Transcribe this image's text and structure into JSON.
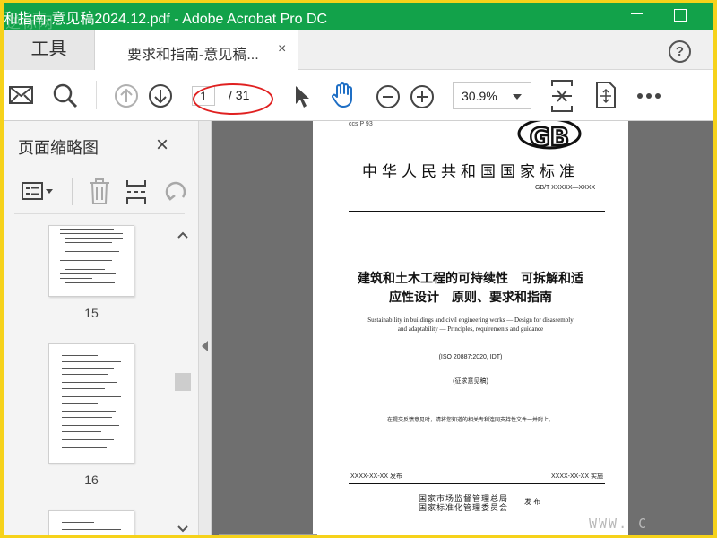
{
  "window": {
    "title": "和指南-意见稿2024.12.pdf - Adobe Acrobat Pro DC",
    "brand_overlay": "逆标网"
  },
  "tabs": {
    "tools": "工具",
    "document": "要求和指南-意见稿...",
    "close": "×",
    "help": "?"
  },
  "toolbar": {
    "page_current": "1",
    "page_total": "/ 31",
    "zoom": "30.9%"
  },
  "thumbnail_panel": {
    "title": "页面缩略图",
    "close": "×",
    "page_numbers": [
      "15",
      "16"
    ]
  },
  "page": {
    "ccs": "ccs P 93",
    "logo": "GB",
    "national_standard": "中华人民共和国国家标准",
    "std_number": "GB/T XXXXX—XXXX",
    "title_line1": "建筑和土木工程的可持续性　可拆解和适",
    "title_line2": "应性设计　原则、要求和指南",
    "english_line1": "Sustainability in buildings and civil engineering works — Design for disassembly",
    "english_line2": "and adaptability — Principles, requirements and guidance",
    "iso_ref": "(ISO 20887:2020, IDT)",
    "draft_label": "(征求意见稿)",
    "note": "在提交反馈意见时，请将您知道的相关专利连同支持性文件一并附上。",
    "publish_date": "XXXX-XX-XX 发布",
    "implement_date": "XXXX-XX-XX 实施",
    "issuer_line1": "国家市场监督管理总局",
    "issuer_line2": "国家标准化管理委员会",
    "issue_label": "发 布"
  },
  "watermark": "WWW. C",
  "colors": {
    "titlebar": "#12a24a",
    "frame": "#f6d21a",
    "hand_tool": "#1f6fc5",
    "annotation": "#e02020"
  }
}
